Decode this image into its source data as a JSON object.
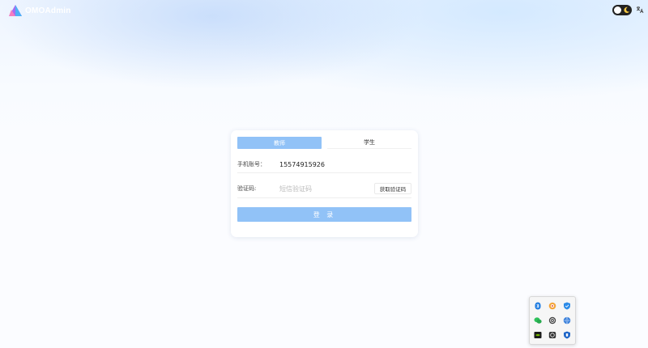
{
  "header": {
    "brand_name": "OMOAdmin",
    "theme_toggle_icon": "moon-icon",
    "language_icon": "translate-icon"
  },
  "login": {
    "tabs": [
      {
        "label": "教师",
        "active": true
      },
      {
        "label": "学生",
        "active": false
      }
    ],
    "phone_label": "手机账号：",
    "phone_value": "15574915926",
    "code_label": "验证码:",
    "code_placeholder": "短信验证码",
    "get_code_button": "获取验证码",
    "submit_button": "登 录"
  },
  "colors": {
    "primary": "#91c2f7",
    "background": "#fbfcff",
    "card": "#ffffff"
  },
  "tray": {
    "icons": [
      "bluetooth-icon",
      "color-wheel-icon",
      "shield-check-icon",
      "wechat-icon",
      "sync-icon",
      "globe-icon",
      "nvidia-icon",
      "camera-icon",
      "security-icon"
    ]
  }
}
